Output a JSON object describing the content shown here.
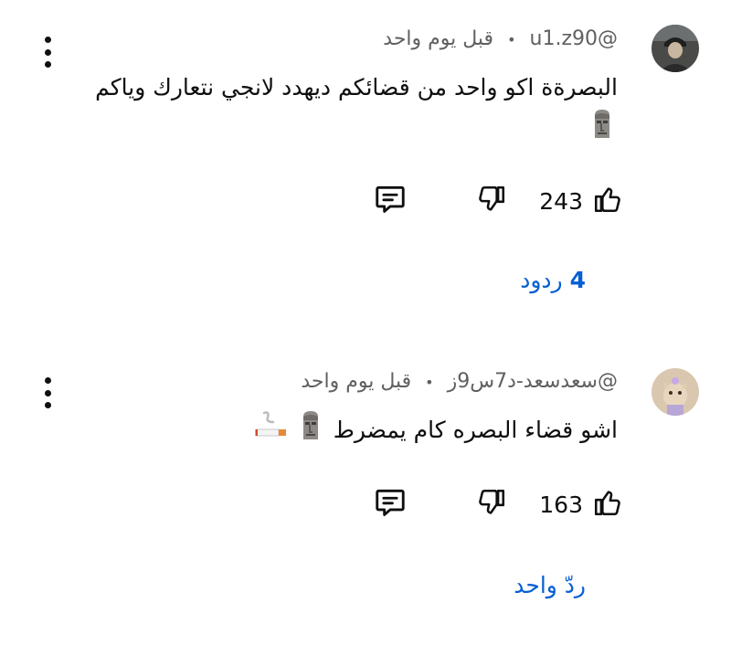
{
  "comments": [
    {
      "handle": "@u1.z90",
      "separator": "•",
      "time": "قبل يوم واحد",
      "text": "البصرةة اكو واحد من قضائكم ديهدد لانجي نتعارك وياكم",
      "emojis": [
        "moai-emoji"
      ],
      "likes": "243",
      "replies_count": "4",
      "replies_label": "ردود"
    },
    {
      "handle": "@سعدسعد-د7س9ز",
      "separator": "•",
      "time": "قبل يوم واحد",
      "text": "اشو قضاء البصره كام يمضرط",
      "emojis": [
        "moai-emoji",
        "cigarette-emoji"
      ],
      "likes": "163",
      "replies_label": "ردّ واحد"
    }
  ],
  "icons": {
    "like": "thumbs-up-icon",
    "dislike": "thumbs-down-icon",
    "reply": "comment-reply-icon",
    "more": "more-vertical-icon"
  },
  "colors": {
    "link": "#065fd4",
    "meta": "#606060",
    "text": "#0f0f0f"
  }
}
